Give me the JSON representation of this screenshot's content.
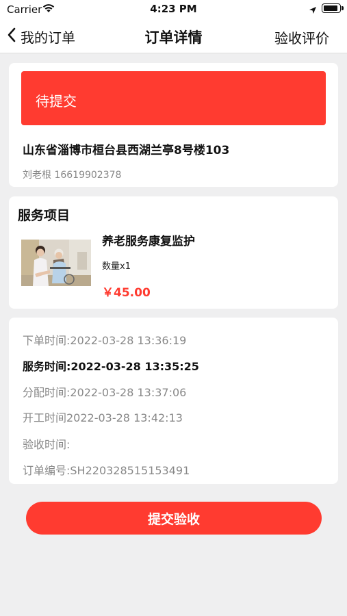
{
  "status_bar": {
    "carrier": "Carrier",
    "time": "4:23 PM"
  },
  "nav": {
    "back_label": "我的订单",
    "title": "订单详情",
    "right_action": "验收评价"
  },
  "order": {
    "status": "待提交",
    "address": "山东省淄博市桓台县西湖兰亭8号楼103",
    "contact": "刘老根 16619902378"
  },
  "service": {
    "section_title": "服务项目",
    "name": "养老服务康复监护",
    "quantity": "数量x1",
    "price": "￥45.00"
  },
  "times": {
    "order_time": "下单时间:2022-03-28 13:36:19",
    "service_time": "服务时间:2022-03-28 13:35:25",
    "assign_time": "分配时间:2022-03-28 13:37:06",
    "start_time": "开工时间2022-03-28 13:42:13",
    "accept_time": "验收时间:",
    "order_no": "订单编号:SH220328515153491"
  },
  "actions": {
    "submit_label": "提交验收"
  },
  "colors": {
    "accent": "#ff3b30",
    "background": "#efeff0",
    "card": "#ffffff",
    "muted_text": "#888888"
  },
  "icons": {
    "back": "chevron-left-icon",
    "wifi": "wifi-icon",
    "location": "location-arrow-icon",
    "battery": "battery-icon"
  }
}
